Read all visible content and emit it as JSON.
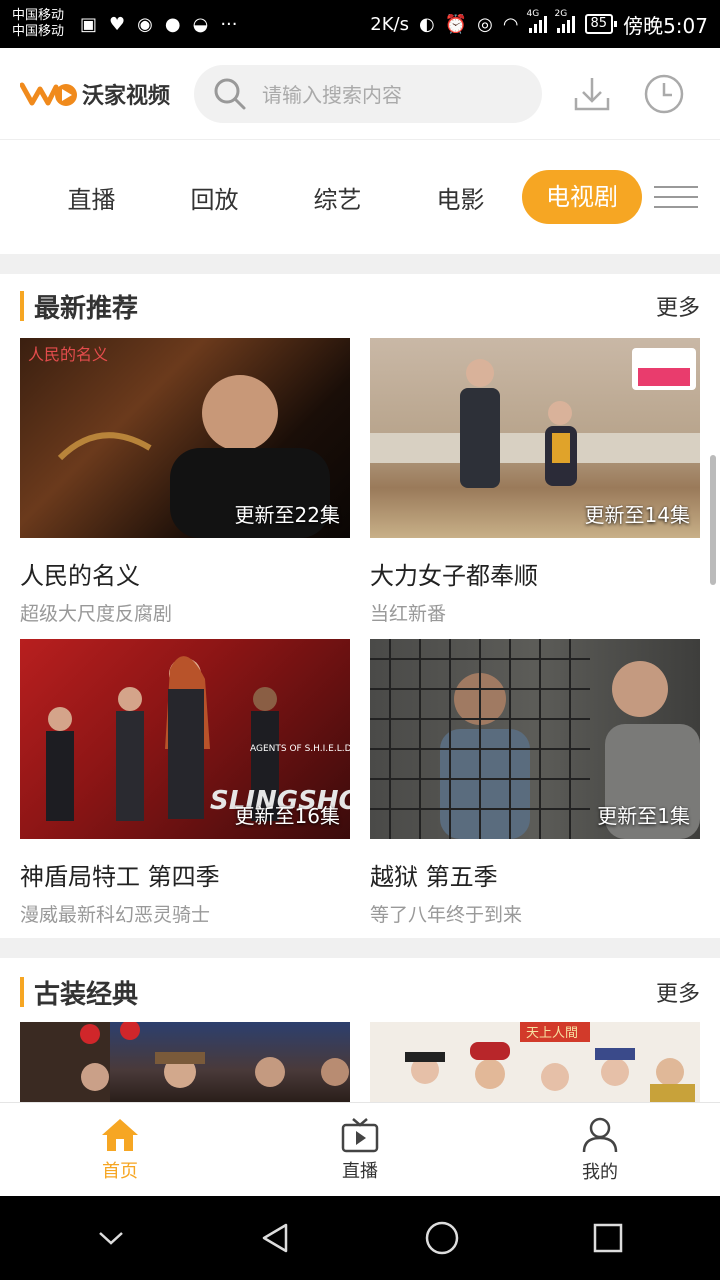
{
  "status_bar": {
    "carrier_1": "中国移动",
    "carrier_2": "中国移动",
    "more": "···",
    "speed": "2K/s",
    "net_1": "4G",
    "net_2": "2G",
    "battery": "85",
    "time": "傍晚5:07"
  },
  "header": {
    "logo_text": "沃家视频",
    "search_placeholder": "请输入搜索内容"
  },
  "tabs": [
    {
      "label": "直播",
      "active": false
    },
    {
      "label": "回放",
      "active": false
    },
    {
      "label": "综艺",
      "active": false
    },
    {
      "label": "电影",
      "active": false
    },
    {
      "label": "电视剧",
      "active": true
    }
  ],
  "sections": [
    {
      "title": "最新推荐",
      "more": "更多",
      "items": [
        {
          "title": "人民的名义",
          "subtitle": "超级大尺度反腐剧",
          "episode": "更新至22集"
        },
        {
          "title": "大力女子都奉顺",
          "subtitle": "当红新番",
          "episode": "更新至14集"
        },
        {
          "title": "神盾局特工 第四季",
          "subtitle": "漫威最新科幻恶灵骑士",
          "episode": "更新至16集"
        },
        {
          "title": "越狱 第五季",
          "subtitle": "等了八年终于到来",
          "episode": "更新至1集"
        }
      ]
    },
    {
      "title": "古装经典",
      "more": "更多",
      "items": [
        {
          "title": "",
          "subtitle": "",
          "episode": ""
        },
        {
          "title": "",
          "subtitle": "",
          "episode": ""
        }
      ]
    }
  ],
  "bottom_nav": [
    {
      "label": "首页",
      "icon": "home-icon",
      "active": true
    },
    {
      "label": "直播",
      "icon": "tv-icon",
      "active": false
    },
    {
      "label": "我的",
      "icon": "person-icon",
      "active": false
    }
  ],
  "colors": {
    "accent": "#f6a623",
    "status_bar": "#000000",
    "subtitle": "#999999"
  }
}
